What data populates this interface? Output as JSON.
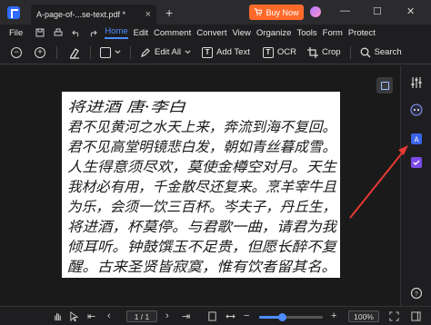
{
  "titlebar": {
    "tab_title": "A-page-of-...se-text.pdf *",
    "tab_close": "×",
    "new_tab": "+",
    "buy_now": "Buy Now",
    "minimize": "—",
    "maximize": "☐",
    "close": "✕"
  },
  "menu": {
    "file": "File",
    "items": [
      "Home",
      "Edit",
      "Comment",
      "Convert",
      "View",
      "Organize",
      "Tools",
      "Form",
      "Protect"
    ],
    "active": "Home"
  },
  "toolbar": {
    "edit_all": "Edit All",
    "add_text": "Add Text",
    "ocr": "OCR",
    "crop": "Crop",
    "search": "Search",
    "ocr_icon_glyph": "T",
    "add_text_icon_glyph": "T"
  },
  "document": {
    "lines": [
      "将进酒    唐·李白",
      "君不见黄河之水天上来，奔流到海不复回。",
      "君不见高堂明镜悲白发，朝如青丝暮成雪。",
      "人生得意须尽欢，莫使金樽空对月。天生",
      "我材必有用，千金散尽还复来。烹羊宰牛且",
      "为乐，会须一饮三百杯。岑夫子，丹丘生，",
      "将进酒，杯莫停。与君歌一曲，请君为我",
      "倾耳听。钟鼓馔玉不足贵，但愿长醉不复",
      "醒。古来圣贤皆寂寞，惟有饮者留其名。"
    ]
  },
  "status": {
    "page_indicator": "1 / 1",
    "zoom": "100%",
    "zoom_fraction": 0.35
  },
  "colors": {
    "accent": "#4e8cff",
    "buy_now": "#ff6a2b",
    "arrow": "#e53935"
  }
}
